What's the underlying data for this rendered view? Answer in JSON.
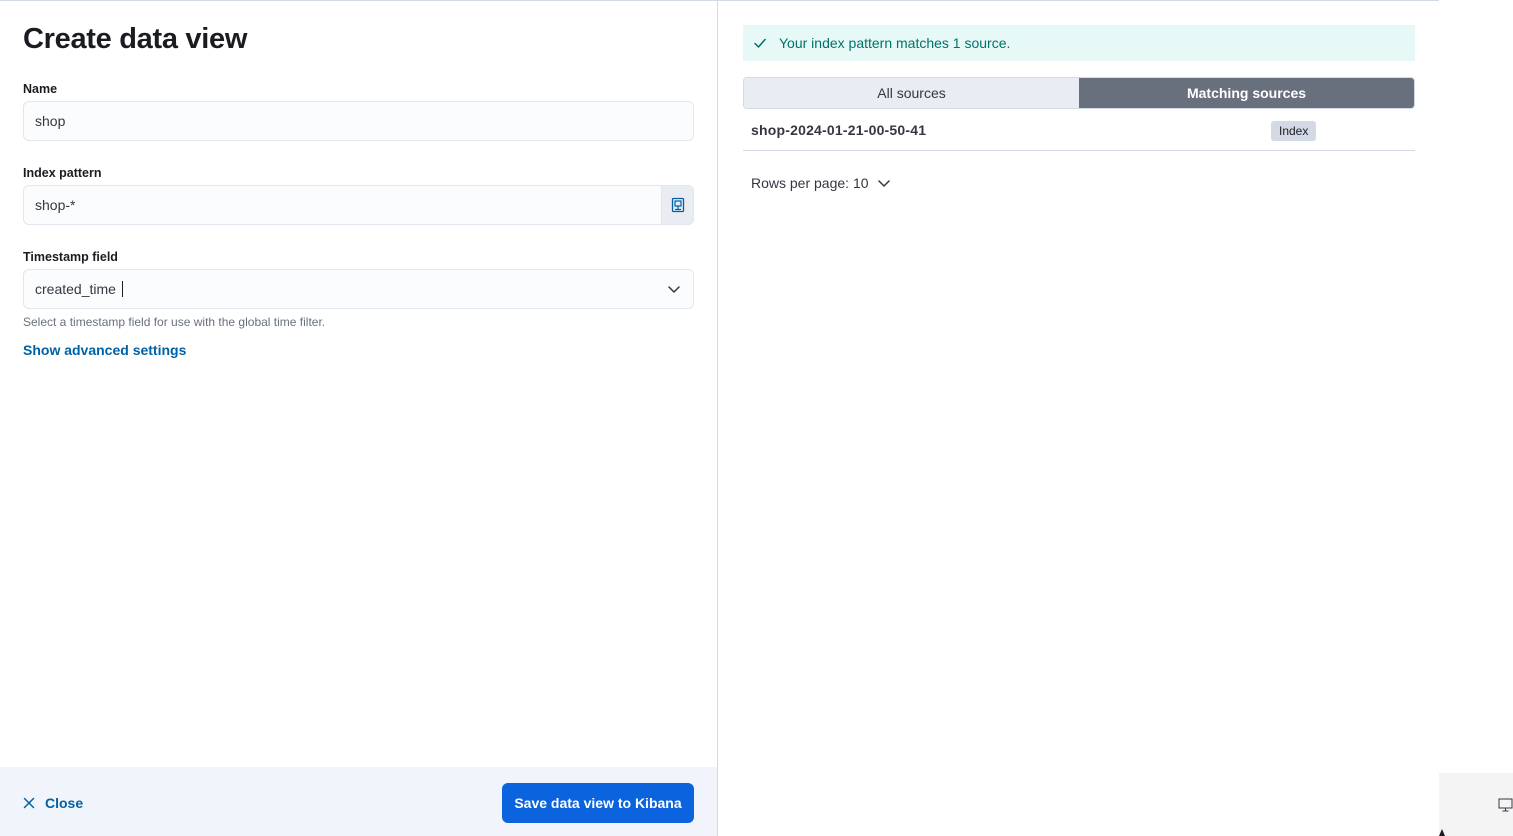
{
  "flyout": {
    "title": "Create data view",
    "name_field": {
      "label": "Name",
      "value": "shop"
    },
    "index_pattern_field": {
      "label": "Index pattern",
      "value": "shop-*",
      "append_icon": "index-mapping-icon"
    },
    "timestamp_field": {
      "label": "Timestamp field",
      "value": "created_time",
      "help": "Select a timestamp field for use with the global time filter."
    },
    "advanced_link": "Show advanced settings",
    "footer": {
      "close_label": "Close",
      "save_label": "Save data view to Kibana"
    }
  },
  "preview": {
    "callout": "Your index pattern matches 1 source.",
    "tabs": [
      {
        "label": "All sources",
        "active": false
      },
      {
        "label": "Matching sources",
        "active": true
      }
    ],
    "sources": [
      {
        "name": "shop-2024-01-21-00-50-41",
        "type": "Index"
      }
    ],
    "rows_per_page": "Rows per page: 10"
  },
  "colors": {
    "primary": "#0b64dd",
    "link": "#0061a6",
    "success_text": "#00726b",
    "success_bg": "#e6f9f7",
    "tab_active": "#69707d"
  }
}
